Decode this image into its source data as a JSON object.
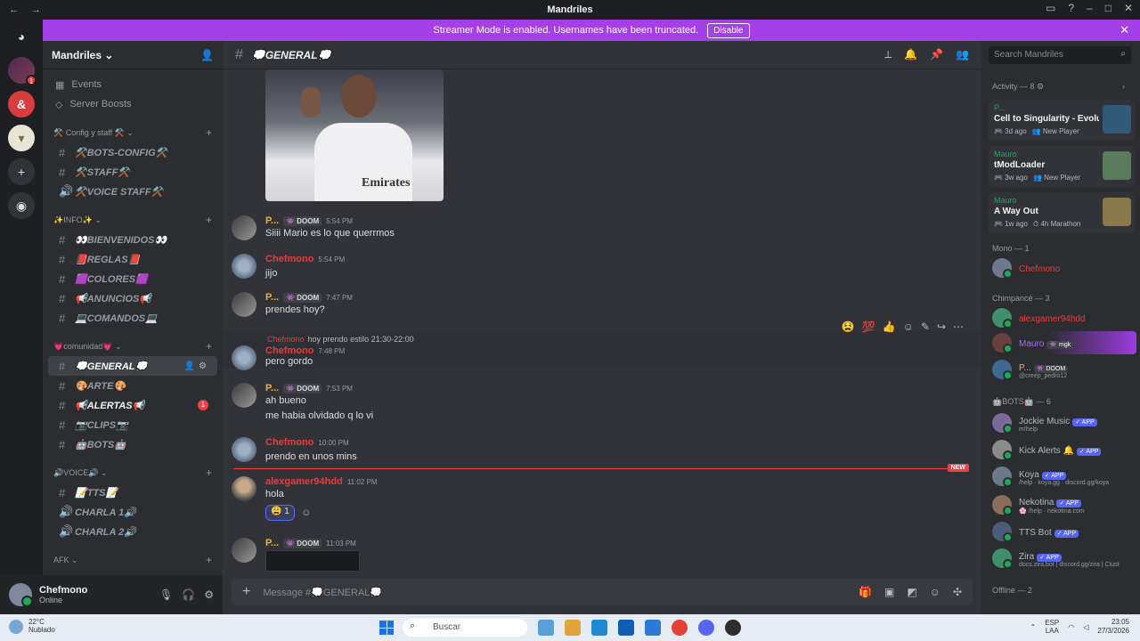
{
  "window": {
    "title": "Mandriles",
    "back": "←",
    "forward": "→"
  },
  "banner": {
    "text": "Streamer Mode is enabled. Usernames have been truncated.",
    "button": "Disable",
    "close": "✕"
  },
  "server_name": "Mandriles ⌄",
  "server_items": [
    {
      "label": "Events",
      "icon": "calendar-icon"
    },
    {
      "label": "Server Boosts",
      "icon": "boost-icon"
    }
  ],
  "categories": [
    {
      "label": "⚒️ Config y staff ⚒️ ⌄",
      "channels": [
        {
          "icon": "#",
          "label": "⚒️BOTS-CONFIG⚒️"
        },
        {
          "icon": "#",
          "label": "⚒️STAFF⚒️"
        },
        {
          "icon": "🔊",
          "label": "⚒️VOICE STAFF⚒️"
        }
      ]
    },
    {
      "label": "✨INFO✨ ⌄",
      "channels": [
        {
          "icon": "#",
          "label": "👀BIENVENIDOS👀"
        },
        {
          "icon": "#",
          "label": "📕REGLAS📕"
        },
        {
          "icon": "#",
          "label": "🟪COLORES🟪"
        },
        {
          "icon": "#",
          "label": "📢ANUNCIOS📢"
        },
        {
          "icon": "#",
          "label": "💻COMANDOS💻"
        }
      ]
    },
    {
      "label": "💗comunidad💗 ⌄",
      "channels": [
        {
          "icon": "#",
          "label": "💭GENERAL💭",
          "active": true
        },
        {
          "icon": "#",
          "label": "🎨ARTE🎨"
        },
        {
          "icon": "#",
          "label": "📢ALERTAS📢",
          "unread": true,
          "badge": "1"
        },
        {
          "icon": "#",
          "label": "📷CLIPS📷"
        },
        {
          "icon": "#",
          "label": "🤖BOTS🤖"
        }
      ]
    },
    {
      "label": "🔊VOICE🔊 ⌄",
      "channels": [
        {
          "icon": "#",
          "label": "📝TTS📝"
        },
        {
          "icon": "🔊",
          "label": "CHARLA 1🔊"
        },
        {
          "icon": "🔊",
          "label": "CHARLA 2🔊"
        }
      ]
    },
    {
      "label": "AFK ⌄",
      "channels": []
    }
  ],
  "user": {
    "name": "Chefmono",
    "status": "Online"
  },
  "channel": {
    "name": "💭GENERAL💭"
  },
  "image_attachment": {
    "caption": "Emirates"
  },
  "messages": [
    {
      "author": "P...",
      "tag": "👾 DOOM",
      "time": "5:54 PM",
      "text": "Siiii Mario es lo que querrmos"
    },
    {
      "author": "Chefmono",
      "time": "5:54 PM",
      "text": "jijo"
    },
    {
      "author": "P...",
      "tag": "👾 DOOM",
      "time": "7:47 PM",
      "text": "prendes hoy?"
    },
    {
      "author": "Chefmono",
      "time": "7:48 PM",
      "text": "pero gordo",
      "reply_author": "Chefmono",
      "reply_text": "hoy prendo estilo 21:30-22:00"
    },
    {
      "author": "P...",
      "tag": "👾 DOOM",
      "time": "7:53 PM",
      "text": "ah bueno",
      "text2": "me habia olvidado q lo vi"
    },
    {
      "author": "Chefmono",
      "time": "10:00 PM",
      "text": "prendo en unos mins"
    },
    {
      "author": "alexgamer94hdd",
      "time": "11:02 PM",
      "text": "hola",
      "reaction": "😩 1"
    },
    {
      "author": "P...",
      "tag": "👾 DOOM",
      "time": "11:03 PM"
    }
  ],
  "new_label": "NEW",
  "composer": {
    "placeholder": "Message #💭GENERAL💭"
  },
  "search": {
    "placeholder": "Search Mandriles"
  },
  "activity": {
    "header": "Activity — 8 ⚙",
    "items": [
      {
        "user": "P...",
        "game": "Cell to Singularity - Evoluti...",
        "ago": "🎮 3d ago",
        "status": "👥 New Player"
      },
      {
        "user": "Mauro",
        "game": "tModLoader",
        "ago": "🎮 3w ago",
        "status": "👥 New Player"
      },
      {
        "user": "Mauro",
        "game": "A Way Out",
        "ago": "🎮 1w ago",
        "status": "⏱ 4h Marathon"
      }
    ]
  },
  "roles": [
    {
      "label": "Mono — 1",
      "members": [
        {
          "name": "Chefmono",
          "color": "red"
        }
      ]
    },
    {
      "label": "Chimpancé — 3",
      "members": [
        {
          "name": "alexgamer94hdd",
          "color": "red"
        },
        {
          "name": "Mauro",
          "color": "purple",
          "tag": "👾 mgk",
          "highlight": true
        },
        {
          "name": "P...",
          "color": "gold",
          "tag": "👾 DOOM",
          "sub": "@creep_pedro12"
        }
      ]
    },
    {
      "label": "🤖BOTS🤖 — 6",
      "members": [
        {
          "name": "Jockie Music",
          "app": "✓ APP",
          "sub": "m!help"
        },
        {
          "name": "Kick Alerts 🔔",
          "app": "✓ APP"
        },
        {
          "name": "Koya",
          "app": "✓ APP",
          "sub": "/help · koya.gg · discord.gg/koya"
        },
        {
          "name": "Nekotina",
          "app": "✓ APP",
          "sub": "🌸 /help · nekotina.com"
        },
        {
          "name": "TTS Bot",
          "app": "✓ APP"
        },
        {
          "name": "Zira",
          "app": "✓ APP",
          "sub": "docs.zira.bot | discord.gg/zira | Clust"
        }
      ]
    },
    {
      "label": "Offline — 2",
      "members": []
    }
  ],
  "taskbar": {
    "temp": "22°C",
    "weather": "Nublado",
    "search": "Buscar",
    "lang": "ESP",
    "lang2": "LAA",
    "time": "23:05",
    "date": "27/3/2026"
  },
  "colors": {
    "accent": "#5865f2",
    "banner": "#a53fe8",
    "red_name": "#e83c3c",
    "gold_name": "#f0b232"
  }
}
